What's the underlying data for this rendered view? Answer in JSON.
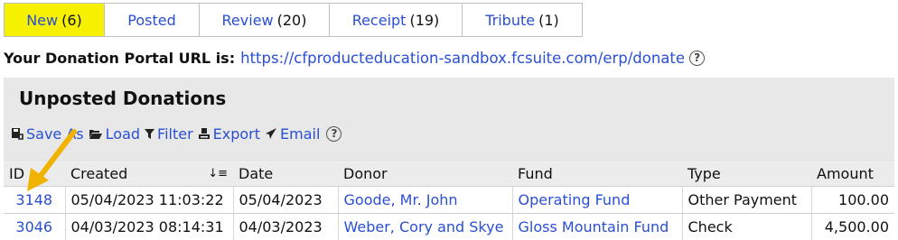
{
  "tabs": [
    {
      "label": "New",
      "count": "(6)",
      "active": true
    },
    {
      "label": "Posted",
      "count": "",
      "active": false
    },
    {
      "label": "Review",
      "count": "(20)",
      "active": false
    },
    {
      "label": "Receipt",
      "count": "(19)",
      "active": false
    },
    {
      "label": "Tribute",
      "count": "(1)",
      "active": false
    }
  ],
  "portal": {
    "label": "Your Donation Portal URL is:",
    "url": "https://cfproducteducation-sandbox.fcsuite.com/erp/donate",
    "help": "?"
  },
  "panel": {
    "title": "Unposted Donations"
  },
  "toolbar": {
    "save_as": "Save As",
    "load": "Load",
    "filter": "Filter",
    "export": "Export",
    "email": "Email",
    "help": "?"
  },
  "table": {
    "headers": [
      "ID",
      "Created",
      "Date",
      "Donor",
      "Fund",
      "Type",
      "Amount"
    ],
    "rows": [
      [
        "3148",
        "05/04/2023 11:03:22",
        "05/04/2023",
        "Goode, Mr. John",
        "Operating Fund",
        "Other Payment",
        "100.00"
      ],
      [
        "3046",
        "04/03/2023 08:14:31",
        "04/03/2023",
        "Weber, Cory and Skye",
        "Gloss Mountain Fund",
        "Check",
        "4,500.00"
      ]
    ]
  },
  "colors": {
    "active_tab": "#f5f100",
    "link": "#2a4fd3",
    "panel": "#e8e8e8",
    "arrow": "#f0b400"
  }
}
